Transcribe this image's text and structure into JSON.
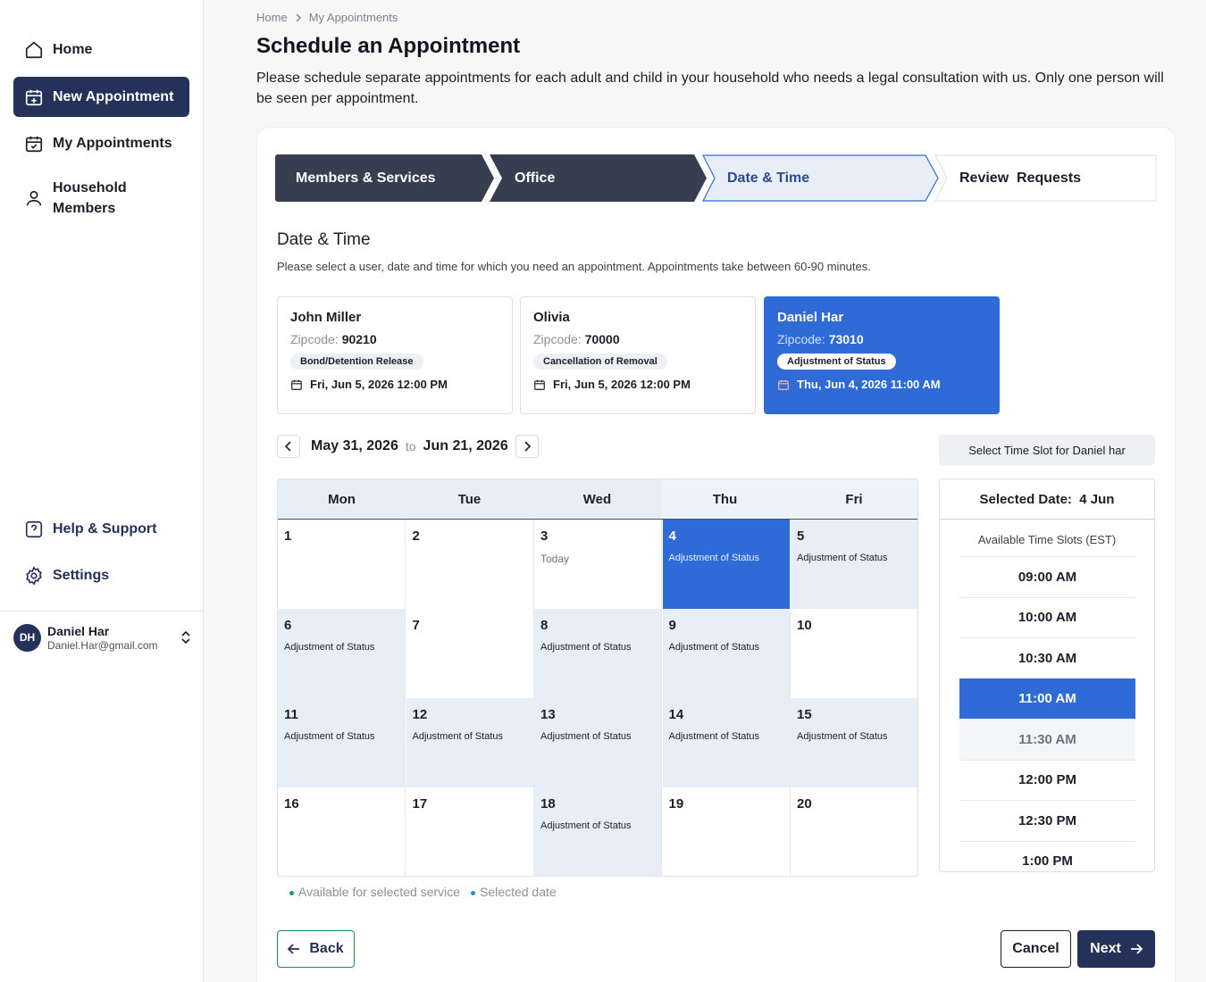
{
  "sidebar": {
    "items": [
      {
        "label": "Home",
        "icon": "home-icon"
      },
      {
        "label": "New Appointment",
        "icon": "calendar-plus-icon",
        "active": true
      },
      {
        "label": "My Appointments",
        "icon": "calendar-check-icon"
      },
      {
        "label": "Household Members",
        "label_line1": "Household",
        "label_line2": "Members",
        "icon": "user-icon"
      }
    ],
    "bottom_items": [
      {
        "label": "Help & Support",
        "icon": "help-icon"
      },
      {
        "label": "Settings",
        "icon": "gear-icon"
      }
    ],
    "user": {
      "initials": "DH",
      "name": "Daniel Har",
      "email": "Daniel.Har@gmail.com"
    }
  },
  "breadcrumb": {
    "home": "Home",
    "current": "My Appointments"
  },
  "page": {
    "title": "Schedule an Appointment",
    "description": "Please schedule separate appointments for each adult and child in your household who needs a legal consultation with us. Only one person will be seen per appointment."
  },
  "stepper": {
    "steps": [
      {
        "label": "Members & Services",
        "state": "done"
      },
      {
        "label": "Office",
        "state": "done"
      },
      {
        "label": "Date & Time",
        "state": "current"
      },
      {
        "label": "Review  Requests",
        "state": "upcoming"
      }
    ]
  },
  "section": {
    "title": "Date & Time",
    "description": "Please select a user, date and time for which you need an appointment. Appointments take between 60-90 minutes."
  },
  "people": [
    {
      "name": "John Miller",
      "zip_label": "Zipcode:",
      "zip": "90210",
      "service": "Bond/Detention Release",
      "datetime": "Fri, Jun 5, 2026 12:00 PM",
      "selected": false
    },
    {
      "name": "Olivia",
      "zip_label": "Zipcode:",
      "zip": "70000",
      "service": "Cancellation of Removal",
      "datetime": "Fri, Jun 5, 2026 12:00 PM",
      "selected": false
    },
    {
      "name": "Daniel Har",
      "zip_label": "Zipcode:",
      "zip": "73010",
      "service": "Adjustment of Status",
      "datetime": "Thu, Jun 4, 2026 11:00 AM",
      "selected": true
    }
  ],
  "range": {
    "start": "May 31, 2026",
    "to": "to",
    "end": "Jun 21, 2026"
  },
  "slot_banner": "Select Time Slot for Daniel har",
  "calendar": {
    "days": [
      "Mon",
      "Tue",
      "Wed",
      "Thu",
      "Fri"
    ],
    "weeks": [
      [
        {
          "day": "1",
          "note": "",
          "state": "none"
        },
        {
          "day": "2",
          "note": "",
          "state": "none"
        },
        {
          "day": "3",
          "note": "Today",
          "state": "today"
        },
        {
          "day": "4",
          "note": "Adjustment of Status",
          "state": "selected"
        },
        {
          "day": "5",
          "note": "Adjustment of Status",
          "state": "available"
        }
      ],
      [
        {
          "day": "6",
          "note": "Adjustment of Status",
          "state": "available"
        },
        {
          "day": "7",
          "note": "",
          "state": "none"
        },
        {
          "day": "8",
          "note": "Adjustment of Status",
          "state": "available"
        },
        {
          "day": "9",
          "note": "Adjustment of Status",
          "state": "available"
        },
        {
          "day": "10",
          "note": "",
          "state": "none"
        }
      ],
      [
        {
          "day": "11",
          "note": "Adjustment of Status",
          "state": "available"
        },
        {
          "day": "12",
          "note": "Adjustment of Status",
          "state": "available"
        },
        {
          "day": "13",
          "note": "Adjustment of Status",
          "state": "available"
        },
        {
          "day": "14",
          "note": "Adjustment of Status",
          "state": "available"
        },
        {
          "day": "15",
          "note": "Adjustment of Status",
          "state": "available"
        }
      ],
      [
        {
          "day": "16",
          "note": "",
          "state": "none"
        },
        {
          "day": "17",
          "note": "",
          "state": "none"
        },
        {
          "day": "18",
          "note": "Adjustment of Status",
          "state": "available"
        },
        {
          "day": "19",
          "note": "",
          "state": "none"
        },
        {
          "day": "20",
          "note": "",
          "state": "none"
        }
      ]
    ]
  },
  "legend": [
    {
      "label": "Available for selected service",
      "color": "#1f9d63"
    },
    {
      "label": "Selected date",
      "color": "#2f8ad6"
    }
  ],
  "slots": {
    "header": "Selected Date:  4 Jun",
    "subheader": "Available Time Slots (EST)",
    "times": [
      "09:00 AM",
      "10:00 AM",
      "10:30 AM",
      "11:00 AM",
      "11:30 AM",
      "12:00 PM",
      "12:30 PM",
      "1:00 PM"
    ],
    "selected": "11:00 AM",
    "hover": "11:30 AM"
  },
  "buttons": {
    "back": "Back",
    "cancel": "Cancel",
    "next": "Next"
  },
  "colors": {
    "navy": "#24325a",
    "primary": "#2f6bd6",
    "available": "#e8eef8",
    "stepper_dark": "#363e4f"
  }
}
